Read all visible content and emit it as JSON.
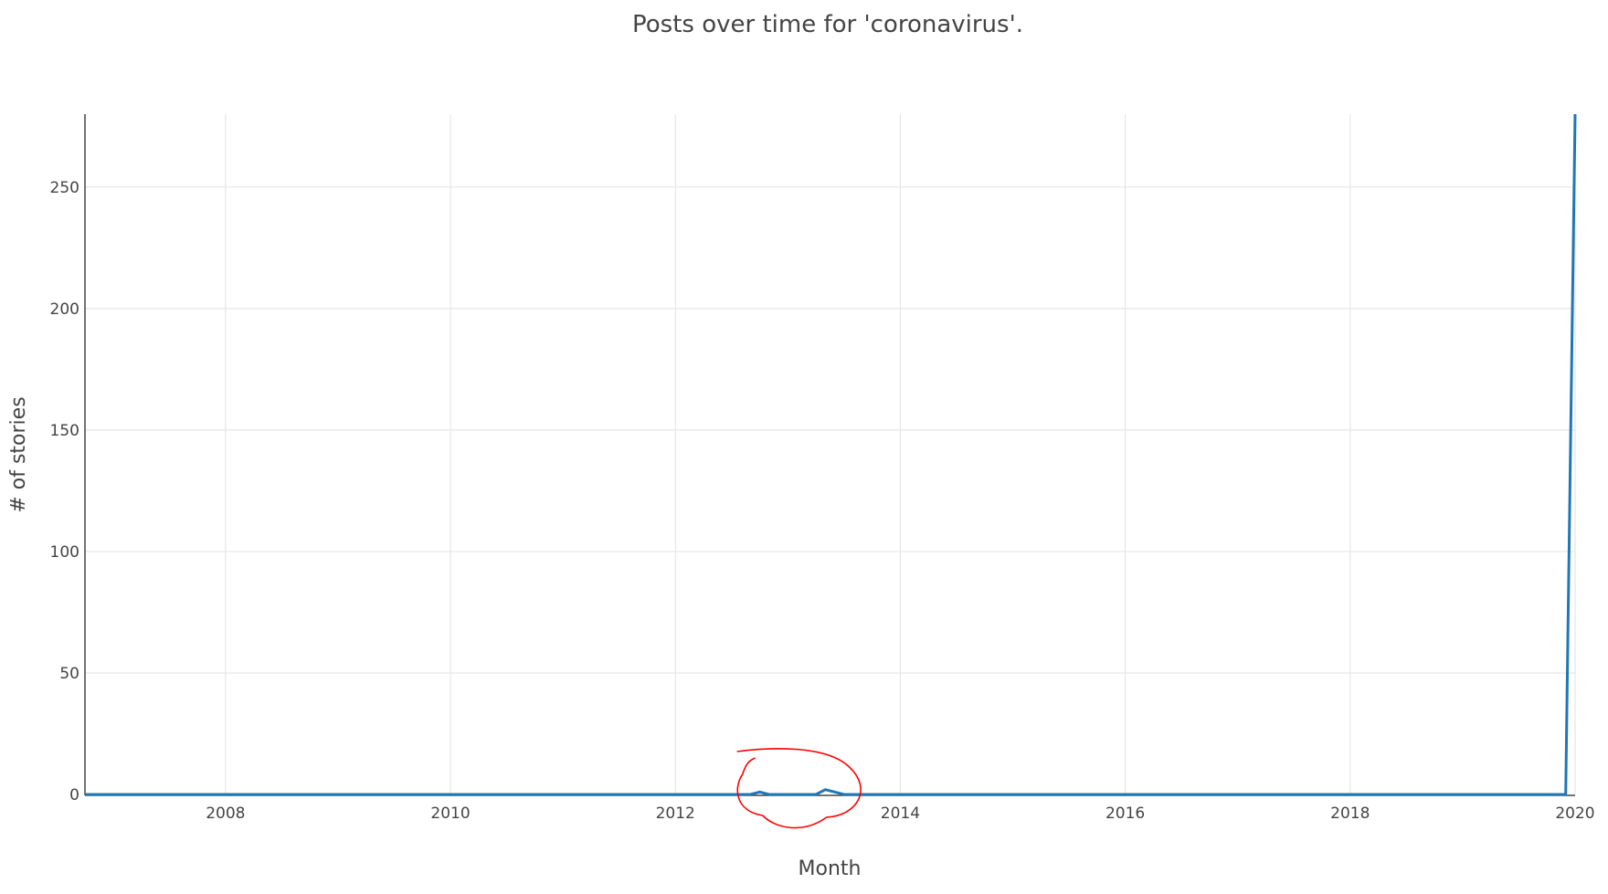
{
  "chart_data": {
    "type": "line",
    "title": "Posts over time for 'coronavirus'.",
    "xlabel": "Month",
    "ylabel": "# of stories",
    "x_range": [
      "2006-10-01",
      "2020-01-01"
    ],
    "xlim_years": [
      2006.75,
      2020.0
    ],
    "ylim": [
      0,
      280
    ],
    "x_ticks": [
      "2008",
      "2010",
      "2012",
      "2014",
      "2016",
      "2018",
      "2020"
    ],
    "y_ticks": [
      "0",
      "50",
      "100",
      "150",
      "200",
      "250"
    ],
    "grid": true,
    "legend": "none",
    "series": [
      {
        "color": "#1f77b4",
        "points": [
          {
            "x": "2006-10",
            "y": 0
          },
          {
            "x": "2012-09",
            "y": 0
          },
          {
            "x": "2012-10",
            "y": 1
          },
          {
            "x": "2012-11",
            "y": 0
          },
          {
            "x": "2013-04",
            "y": 0
          },
          {
            "x": "2013-05",
            "y": 2
          },
          {
            "x": "2013-06",
            "y": 1
          },
          {
            "x": "2013-07",
            "y": 0
          },
          {
            "x": "2019-12",
            "y": 0
          },
          {
            "x": "2020-01",
            "y": 280
          }
        ]
      }
    ],
    "annotation": {
      "type": "hand-drawn-circle",
      "color": "#ff0000",
      "around": "2013"
    }
  }
}
